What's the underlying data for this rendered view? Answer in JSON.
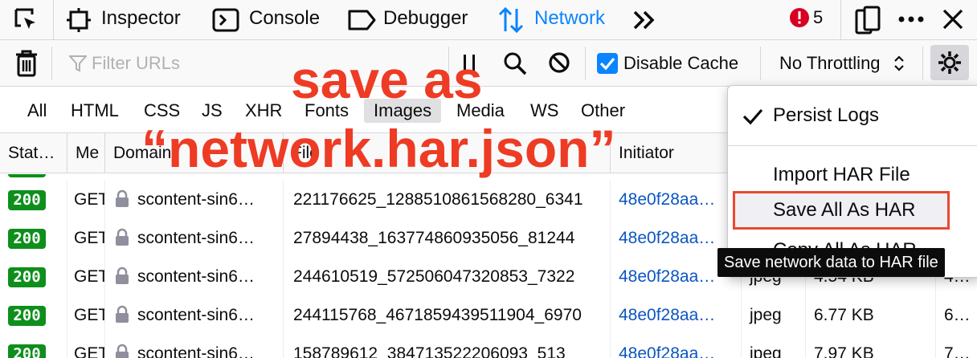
{
  "tabs": {
    "inspector": "Inspector",
    "console": "Console",
    "debugger": "Debugger",
    "network": "Network",
    "error_count": "5"
  },
  "toolbar": {
    "filter_placeholder": "Filter URLs",
    "disable_cache_label": "Disable Cache",
    "disable_cache_checked": true,
    "throttling": "No Throttling"
  },
  "filters": [
    "All",
    "HTML",
    "CSS",
    "JS",
    "XHR",
    "Fonts",
    "Images",
    "Media",
    "WS",
    "Other"
  ],
  "active_filter": "Images",
  "columns": {
    "status": "Stat…",
    "method": "Me",
    "domain": "Domain",
    "file": "File",
    "initiator": "Initiator"
  },
  "rows": [
    {
      "status": "200",
      "method": "GET",
      "domain": "scontent-sin6…",
      "file": "221176625_1288510861568280_6341",
      "initiator": "48e0f28aa…",
      "type": "",
      "size": "",
      "extra": ""
    },
    {
      "status": "200",
      "method": "GET",
      "domain": "scontent-sin6…",
      "file": "27894438_163774860935056_81244",
      "initiator": "48e0f28aa…",
      "type": "",
      "size": "",
      "extra": ""
    },
    {
      "status": "200",
      "method": "GET",
      "domain": "scontent-sin6…",
      "file": "244610519_572506047320853_7322",
      "initiator": "48e0f28aa…",
      "type": "jpeg",
      "size": "4.54 KB",
      "extra": "4…"
    },
    {
      "status": "200",
      "method": "GET",
      "domain": "scontent-sin6…",
      "file": "244115768_4671859439511904_6970",
      "initiator": "48e0f28aa…",
      "type": "jpeg",
      "size": "6.77 KB",
      "extra": "6…"
    },
    {
      "status": "200",
      "method": "GET",
      "domain": "scontent-sin6…",
      "file": "158789612_384713522206093_513",
      "initiator": "48e0f28aa…",
      "type": "jpeg",
      "size": "7.97 KB",
      "extra": "7…"
    }
  ],
  "menu": {
    "persist_logs": "Persist Logs",
    "persist_logs_checked": true,
    "import_har": "Import HAR File",
    "save_all_har": "Save All As HAR",
    "copy_all_har": "Copy All As HAR"
  },
  "tooltip": "Save network data to HAR file",
  "annotation": {
    "line1": "save as",
    "line2": "“network.har.json”"
  },
  "colors": {
    "accent": "#0a84ff",
    "status_ok": "#0e8f1b",
    "error": "#d70022",
    "annotation": "#ee3b24",
    "highlight_box": "#e8492f"
  }
}
